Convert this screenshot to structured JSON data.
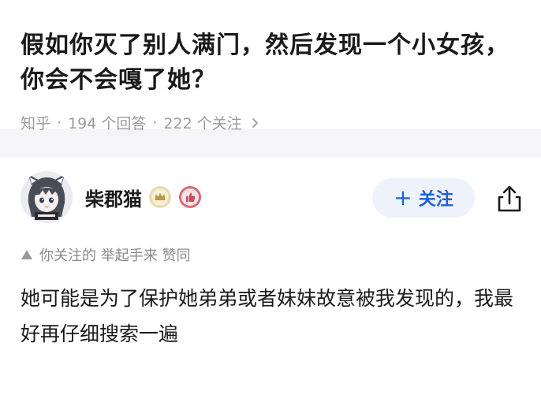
{
  "question": {
    "title": "假如你灭了别人满门，然后发现一个小女孩，你会不会嘎了她？",
    "source": "知乎",
    "separator": "·",
    "answer_count": "194 个回答",
    "follower_count": "222 个关注"
  },
  "answer": {
    "author": {
      "name": "柴郡猫",
      "avatar_icon": "anime-avatar",
      "badges": [
        "level-badge-icon",
        "thumb-badge-icon"
      ]
    },
    "follow_button": {
      "icon": "plus",
      "label": "关注",
      "accent_color": "#1d61d6",
      "background_color": "#eef2fb"
    },
    "share_icon": "share-icon",
    "endorsement": "你关注的 举起手来 赞同",
    "content": "她可能是为了保护她弟弟或者妹妹故意被我发现的，我最好再仔细搜索一遍"
  }
}
